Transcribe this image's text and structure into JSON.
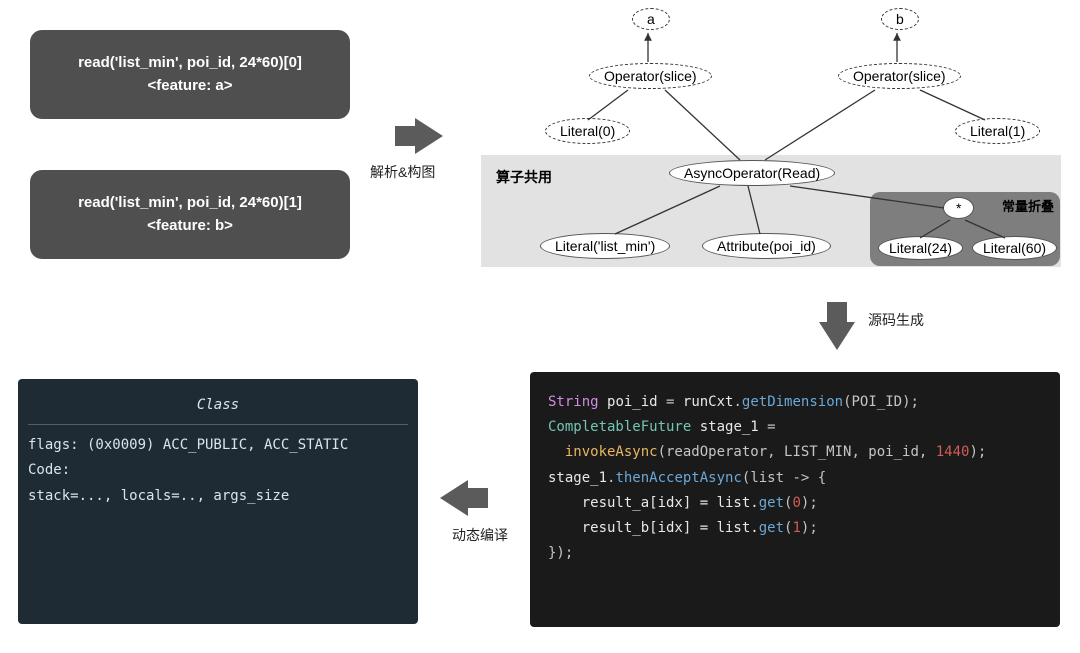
{
  "features": {
    "a": {
      "line1": "read('list_min', poi_id, 24*60)[0]",
      "line2": "<feature: a>"
    },
    "b": {
      "line1": "read('list_min', poi_id, 24*60)[1]",
      "line2": "<feature: b>"
    }
  },
  "steps": {
    "parse": "解析&构图",
    "generate": "源码生成",
    "compile": "动态编译"
  },
  "tree": {
    "a": "a",
    "b": "b",
    "opslice_a": "Operator(slice)",
    "opslice_b": "Operator(slice)",
    "lit0": "Literal(0)",
    "lit1": "Literal(1)",
    "shared_label": "算子共用",
    "fold_label": "常量折叠",
    "async": "AsyncOperator(Read)",
    "lit_listmin": "Literal('list_min')",
    "attr": "Attribute(poi_id)",
    "star": "*",
    "lit24": "Literal(24)",
    "lit60": "Literal(60)"
  },
  "gencode": {
    "l1": {
      "kw": "String",
      "sp": " ",
      "var": "poi_id",
      "eq": " = ",
      "obj": "runCxt",
      "dot": ".",
      "mth": "getDimension",
      "args": "(POI_ID);"
    },
    "l2": {
      "typ": "CompletableFuture",
      "sp": " ",
      "var": "stage_1",
      "eq": " ="
    },
    "l3": {
      "indent": "  ",
      "fn": "invokeAsync",
      "open": "(readOperator, LIST_MIN, poi_id, ",
      "num": "1440",
      "close": ");"
    },
    "l4": {
      "obj": "stage_1",
      "dot": ".",
      "mth": "thenAcceptAsync",
      "args": "(list -> {"
    },
    "l5": {
      "indent": "    ",
      "lhs": "result_a[idx] =  list.",
      "mth": "get",
      "open": "(",
      "num": "0",
      "close": ");"
    },
    "l6": {
      "indent": "    ",
      "lhs": "result_b[idx] =  list.",
      "mth": "get",
      "open": "(",
      "num": "1",
      "close": ");"
    },
    "l7": {
      "txt": "});"
    }
  },
  "classcode": {
    "title": "Class",
    "l1": "flags: (0x0009) ACC_PUBLIC, ACC_STATIC",
    "l2": "Code:",
    "l3": "stack=..., locals=.., args_size"
  }
}
